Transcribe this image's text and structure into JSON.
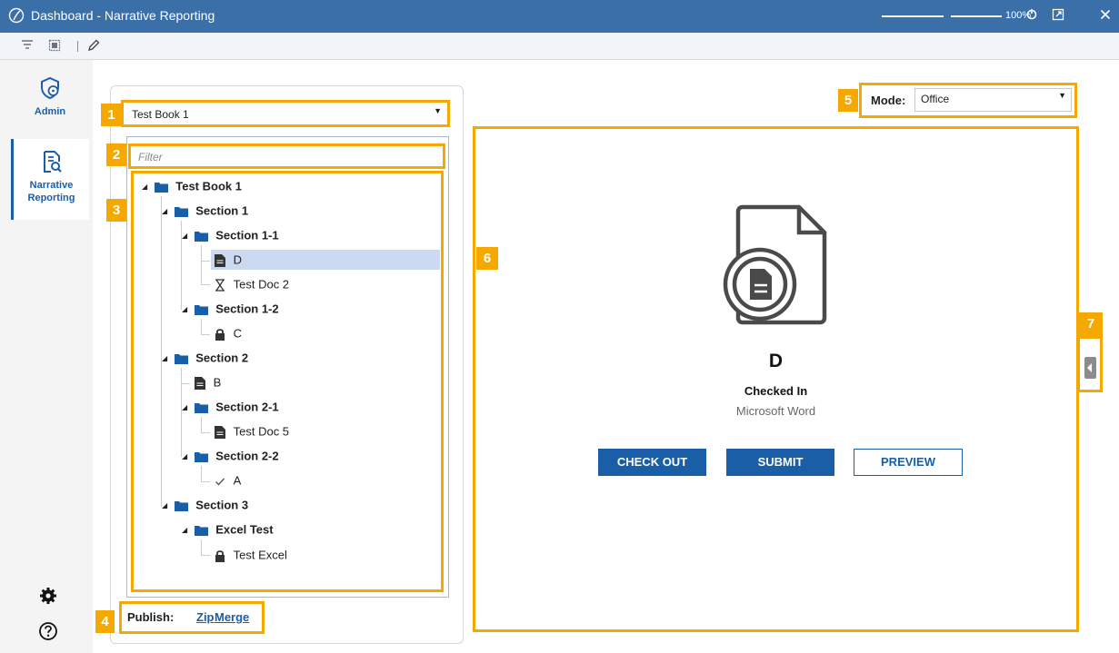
{
  "window": {
    "title": "Dashboard - Narrative Reporting",
    "zoom": "100%"
  },
  "nav": {
    "items": [
      {
        "label": "Admin",
        "icon": "admin-shield-icon"
      },
      {
        "label": "Narrative\nReporting",
        "icon": "narrative-reporting-icon"
      }
    ],
    "bottom_icons": [
      "settings-gear-icon",
      "help-icon"
    ]
  },
  "book_select": {
    "value": "Test Book 1"
  },
  "filter": {
    "placeholder": "Filter"
  },
  "tree": {
    "root": "Test Book 1",
    "section_1": "Section 1",
    "section_1_1": "Section 1-1",
    "doc_d": "D",
    "doc_test_doc_2": "Test Doc 2",
    "section_1_2": "Section 1-2",
    "doc_c": "C",
    "section_2": "Section 2",
    "doc_b": "B",
    "section_2_1": "Section 2-1",
    "doc_test_doc_5": "Test Doc 5",
    "section_2_2": "Section 2-2",
    "doc_a": "A",
    "section_3": "Section 3",
    "excel_test": "Excel Test",
    "doc_test_excel": "Test Excel"
  },
  "publish": {
    "label": "Publish:",
    "zip": "Zip",
    "merge": "Merge"
  },
  "mode": {
    "label": "Mode:",
    "value": "Office"
  },
  "document": {
    "name": "D",
    "status": "Checked In",
    "type": "Microsoft Word",
    "buttons": {
      "check_out": "CHECK OUT",
      "submit": "SUBMIT",
      "preview": "PREVIEW"
    }
  },
  "badges": [
    "1",
    "2",
    "3",
    "4",
    "5",
    "6",
    "7"
  ],
  "colors": {
    "accent": "#1b5ea8",
    "titlebar": "#3b6fa8",
    "highlight": "#f5a800",
    "selection": "#cbdaf1"
  }
}
